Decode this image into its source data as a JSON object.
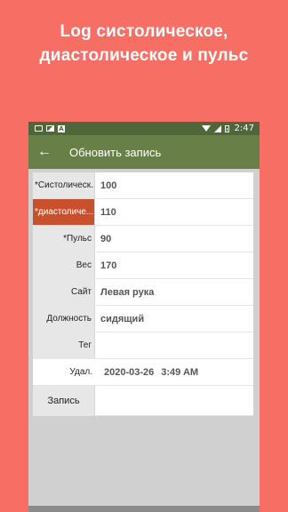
{
  "promo": {
    "line1": "Log систолическое,",
    "line2": "диастолическое и пульс"
  },
  "status_bar": {
    "time": "2:47",
    "icons": [
      "message-icon",
      "image-icon",
      "a-icon",
      "wifi-icon",
      "signal-icon",
      "battery-icon"
    ]
  },
  "app_bar": {
    "title": "Обновить запись",
    "back_icon": "arrow-left-icon"
  },
  "form": {
    "rows": [
      {
        "label": "*Систолическ...",
        "value": "100"
      },
      {
        "label": "*диастоличе...",
        "value": "110"
      },
      {
        "label": "*Пульс",
        "value": "90"
      },
      {
        "label": "Вес",
        "value": "170"
      },
      {
        "label": "Сайт",
        "value": "Левая рука"
      },
      {
        "label": "Должность",
        "value": "сидящий"
      },
      {
        "label": "Тег",
        "value": ""
      },
      {
        "label": "Удал.",
        "date": "2020-03-26",
        "time": "3:49 AM"
      },
      {
        "label": "Запись",
        "value": ""
      }
    ]
  },
  "colors": {
    "background": "#f76e64",
    "status_bar": "#4f663a",
    "app_bar": "#688048",
    "active_label": "#c8502c"
  }
}
